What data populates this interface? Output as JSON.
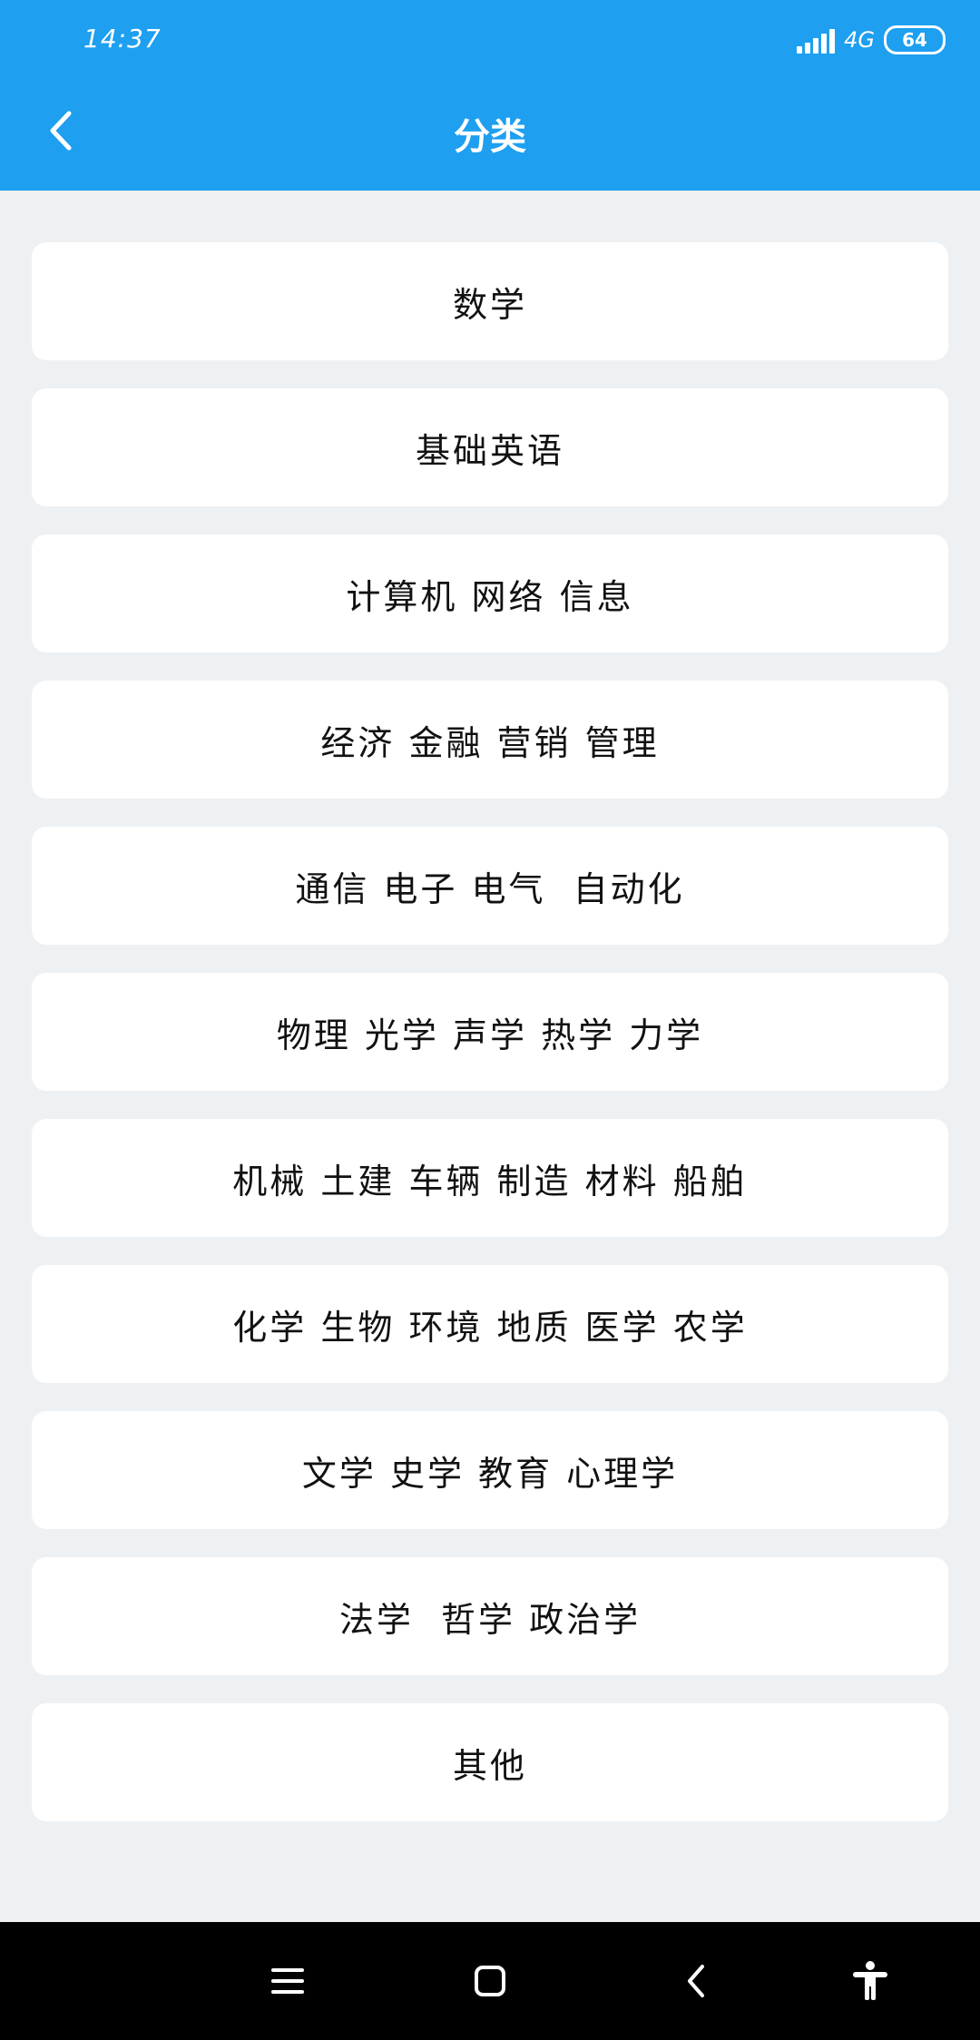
{
  "status_bar": {
    "time": "14:37",
    "network": "4G",
    "battery": "64"
  },
  "title_bar": {
    "title": "分类"
  },
  "categories": [
    {
      "label": "数学"
    },
    {
      "label": "基础英语"
    },
    {
      "label": "计算机 网络 信息"
    },
    {
      "label": "经济 金融 营销 管理"
    },
    {
      "label": "通信 电子 电气  自动化"
    },
    {
      "label": "物理 光学 声学 热学 力学"
    },
    {
      "label": "机械 土建 车辆 制造 材料 船舶"
    },
    {
      "label": "化学 生物 环境 地质 医学 农学"
    },
    {
      "label": "文学 史学 教育 心理学"
    },
    {
      "label": "法学  哲学 政治学"
    },
    {
      "label": "其他"
    }
  ],
  "colors": {
    "header": "#1e9ff0",
    "background": "#eef1f3",
    "card": "#ffffff",
    "nav_bar": "#000000"
  },
  "icons": {
    "back": "chevron-left-icon",
    "nav_menu": "menu-icon",
    "nav_home": "square-home-icon",
    "nav_back": "back-triangle-icon",
    "nav_accessibility": "accessibility-icon"
  }
}
